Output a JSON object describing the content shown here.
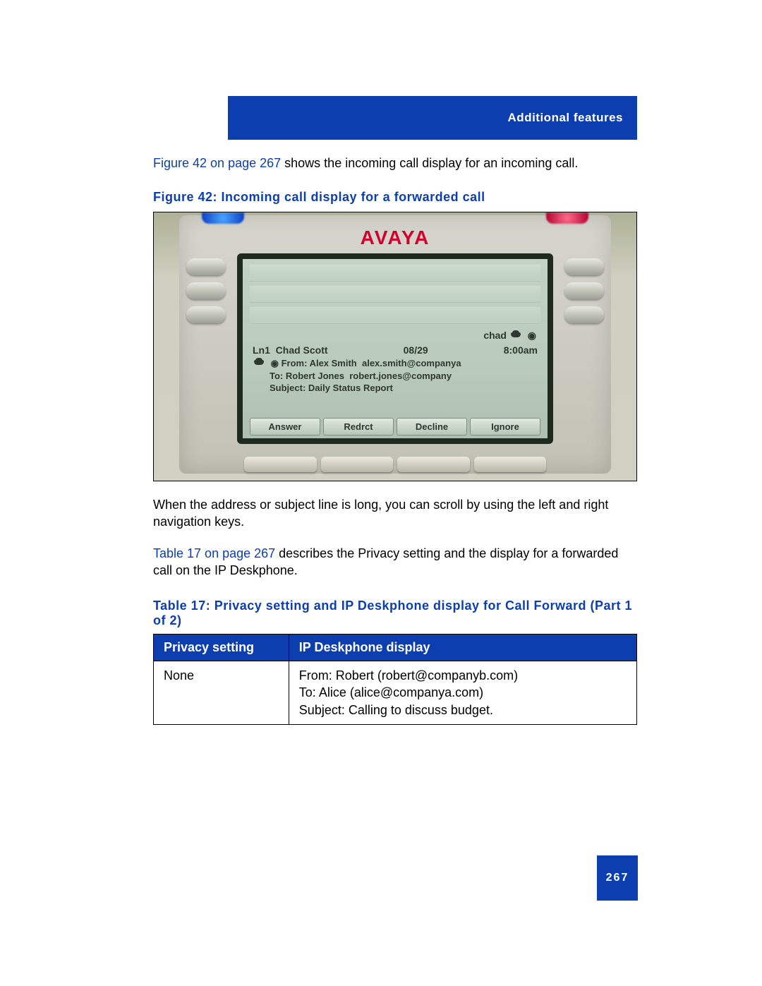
{
  "header": {
    "section": "Additional features"
  },
  "intro": {
    "link": "Figure 42 on page 267",
    "rest": " shows the incoming call display for an incoming call."
  },
  "figure_caption": "Figure 42: Incoming call display for a forwarded call",
  "phone": {
    "logo": "AVAYA",
    "chad_label": "chad",
    "ln1_label": "Ln1",
    "ln1_name": "Chad Scott",
    "ln1_date": "08/29",
    "ln1_time": "8:00am",
    "from_label": "From:",
    "from_name": "Alex Smith",
    "from_addr": "alex.smith@companya",
    "to_label": "To:",
    "to_name": "Robert Jones",
    "to_addr": "robert.jones@company",
    "subject_label": "Subject:",
    "subject_value": "Daily Status Report",
    "softkeys": [
      "Answer",
      "Redrct",
      "Decline",
      "Ignore"
    ]
  },
  "para2": "When the address or subject line is long, you can scroll by using the left and right navigation keys.",
  "para3": {
    "link": "Table 17 on page 267",
    "rest": " describes the Privacy setting and the display for a forwarded call on the IP Deskphone."
  },
  "table_caption": "Table 17: Privacy setting and IP Deskphone display for Call Forward (Part 1 of 2)",
  "table": {
    "headers": [
      "Privacy setting",
      "IP Deskphone display"
    ],
    "row1_col1": "None",
    "row1_col2_l1": "From: Robert (robert@companyb.com)",
    "row1_col2_l2": "To: Alice (alice@companya.com)",
    "row1_col2_l3": "Subject: Calling to discuss budget."
  },
  "page_number": "267"
}
